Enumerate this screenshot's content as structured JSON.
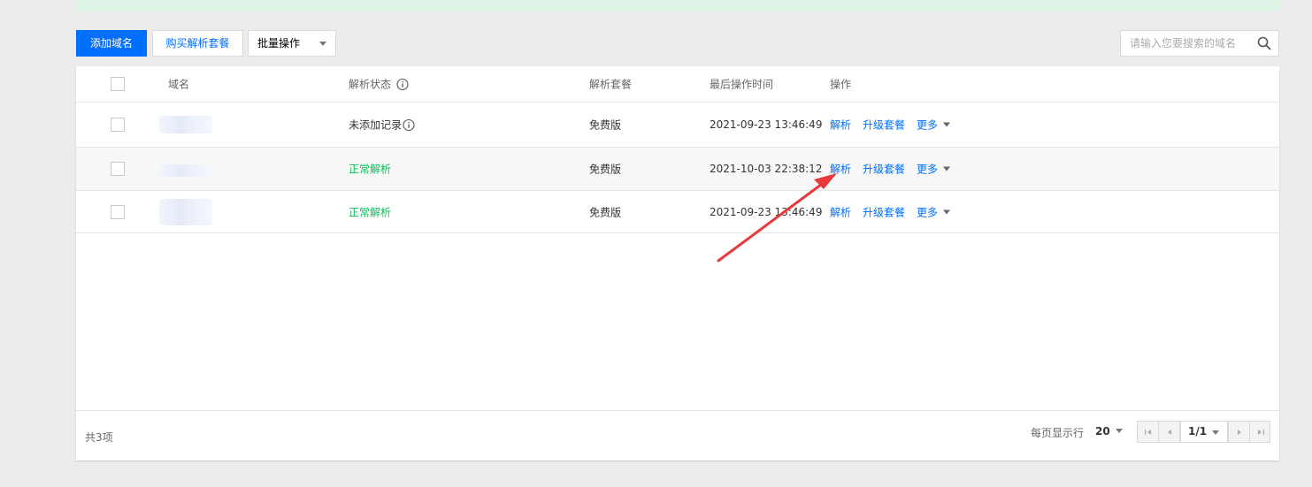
{
  "toolbar": {
    "add_domain_label": "添加域名",
    "buy_package_label": "购买解析套餐",
    "batch_select_value": "批量操作",
    "search_placeholder": "请输入您要搜索的域名"
  },
  "table": {
    "headers": {
      "domain": "域名",
      "status": "解析状态",
      "package": "解析套餐",
      "last_time": "最后操作时间",
      "ops": "操作"
    },
    "rows": [
      {
        "status": "未添加记录",
        "package": "免费版",
        "time": "2021-09-23 13:46:49"
      },
      {
        "status": "正常解析",
        "package": "免费版",
        "time": "2021-10-03 22:38:12"
      },
      {
        "status": "正常解析",
        "package": "免费版",
        "time": "2021-09-23 13:46:49"
      }
    ],
    "ops_labels": {
      "resolve": "解析",
      "upgrade": "升级套餐",
      "more": "更多"
    }
  },
  "footer": {
    "total": "共3项",
    "per_page_label": "每页显示行",
    "per_page_value": "20",
    "page_current": "1/1"
  },
  "colors": {
    "primary": "#006eff",
    "status_ok": "#0abf5b",
    "annotation_arrow": "#e8393b"
  }
}
